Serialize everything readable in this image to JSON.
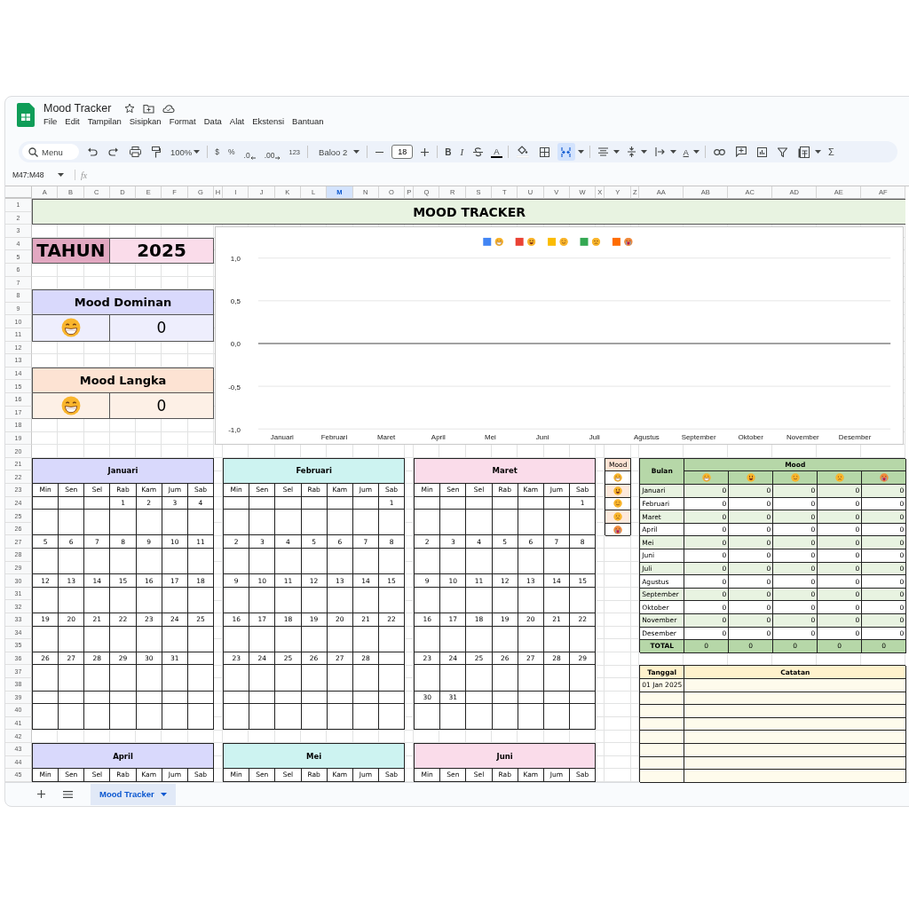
{
  "document": {
    "title": "Mood Tracker",
    "menu": [
      "File",
      "Edit",
      "Tampilan",
      "Sisipkan",
      "Format",
      "Data",
      "Alat",
      "Ekstensi",
      "Bantuan"
    ]
  },
  "toolbar": {
    "search_placeholder": "Menu",
    "zoom": "100%",
    "currency": "$",
    "percent": "%",
    "decrease_decimals": ".0",
    "increase_decimals": ".00",
    "number_format": "123",
    "font": "Baloo 2",
    "font_size": "18",
    "bold": "B",
    "italic": "I",
    "text_color": "A",
    "text_rotation": "A",
    "sum": "Σ",
    "merge_selected": true
  },
  "formula_bar": {
    "cell_range": "M47:M48",
    "function_label": "fx"
  },
  "columns": [
    {
      "label": "A",
      "selected": false
    },
    {
      "label": "B",
      "selected": false
    },
    {
      "label": "C",
      "selected": false
    },
    {
      "label": "D",
      "selected": false
    },
    {
      "label": "E",
      "selected": false
    },
    {
      "label": "F",
      "selected": false
    },
    {
      "label": "G",
      "selected": false
    },
    {
      "label": "H",
      "selected": false
    },
    {
      "label": "I",
      "selected": false
    },
    {
      "label": "J",
      "selected": false
    },
    {
      "label": "K",
      "selected": false
    },
    {
      "label": "L",
      "selected": false
    },
    {
      "label": "M",
      "selected": true
    },
    {
      "label": "N",
      "selected": false
    },
    {
      "label": "O",
      "selected": false
    },
    {
      "label": "P",
      "selected": false
    },
    {
      "label": "Q",
      "selected": false
    },
    {
      "label": "R",
      "selected": false
    },
    {
      "label": "S",
      "selected": false
    },
    {
      "label": "T",
      "selected": false
    },
    {
      "label": "U",
      "selected": false
    },
    {
      "label": "V",
      "selected": false
    },
    {
      "label": "W",
      "selected": false
    },
    {
      "label": "X",
      "selected": false
    },
    {
      "label": "Y",
      "selected": false
    },
    {
      "label": "Z",
      "selected": false
    },
    {
      "label": "AA",
      "selected": false
    },
    {
      "label": "AB",
      "selected": false
    },
    {
      "label": "AC",
      "selected": false
    },
    {
      "label": "AD",
      "selected": false
    },
    {
      "label": "AE",
      "selected": false
    },
    {
      "label": "AF",
      "selected": false
    }
  ],
  "rows": [
    "1",
    "2",
    "3",
    "4",
    "5",
    "6",
    "7",
    "8",
    "9",
    "10",
    "11",
    "12",
    "13",
    "14",
    "15",
    "16",
    "17",
    "18",
    "19",
    "20",
    "21",
    "22",
    "23",
    "24",
    "25",
    "26",
    "27",
    "28",
    "29",
    "30",
    "31",
    "32",
    "33",
    "34",
    "35",
    "36",
    "37",
    "38",
    "39",
    "40",
    "41",
    "42",
    "43",
    "44",
    "45"
  ],
  "title": "MOOD TRACKER",
  "year": {
    "label": "TAHUN",
    "value": "2025"
  },
  "dominant": {
    "title": "Mood Dominan",
    "count": "0"
  },
  "rare": {
    "title": "Mood Langka",
    "count": "0"
  },
  "chart": {
    "chart_data": {
      "type": "line",
      "categories": [
        "Januari",
        "Februari",
        "Maret",
        "April",
        "Mei",
        "Juni",
        "Juli",
        "Agustus",
        "September",
        "Oktober",
        "November",
        "Desember"
      ],
      "ylim": [
        -1,
        1
      ],
      "yticks": [
        {
          "value": -1,
          "label": "-1,0"
        },
        {
          "value": -0.5,
          "label": "-0,5"
        },
        {
          "value": 0,
          "label": "0,0"
        },
        {
          "value": 0.5,
          "label": "0,5"
        },
        {
          "value": 1,
          "label": "1,0"
        }
      ],
      "series": [
        {
          "color": "#4285f4",
          "values": [
            null,
            null,
            null,
            null,
            null,
            null,
            null,
            null,
            null,
            null,
            null,
            null
          ]
        },
        {
          "color": "#ea4335",
          "values": [
            null,
            null,
            null,
            null,
            null,
            null,
            null,
            null,
            null,
            null,
            null,
            null
          ]
        },
        {
          "color": "#fbbc04",
          "values": [
            null,
            null,
            null,
            null,
            null,
            null,
            null,
            null,
            null,
            null,
            null,
            null
          ]
        },
        {
          "color": "#34a853",
          "values": [
            null,
            null,
            null,
            null,
            null,
            null,
            null,
            null,
            null,
            null,
            null,
            null
          ]
        },
        {
          "color": "#ff6d01",
          "values": [
            null,
            null,
            null,
            null,
            null,
            null,
            null,
            null,
            null,
            null,
            null,
            null
          ]
        }
      ]
    }
  },
  "calendars": [
    {
      "name": "Januari",
      "color": "#d9d9fc",
      "day_names": [
        "Min",
        "Sen",
        "Sel",
        "Rab",
        "Kam",
        "Jum",
        "Sab"
      ],
      "weeks": [
        {
          "days": [
            "1",
            "2",
            "3",
            "4"
          ]
        },
        {
          "days": [
            "5",
            "6",
            "7",
            "8",
            "9",
            "10",
            "11"
          ]
        },
        {
          "days": [
            "12",
            "13",
            "14",
            "15",
            "16",
            "17",
            "18"
          ]
        },
        {
          "days": [
            "19",
            "20",
            "21",
            "22",
            "23",
            "24",
            "25"
          ]
        },
        {
          "days": [
            "26",
            "27",
            "28",
            "29",
            "30",
            "31"
          ]
        }
      ]
    },
    {
      "name": "Februari",
      "color": "#cdf3f1",
      "day_names": [
        "Min",
        "Sen",
        "Sel",
        "Rab",
        "Kam",
        "Jum",
        "Sab"
      ],
      "weeks": [
        {
          "days": [
            "1"
          ]
        },
        {
          "days": [
            "2",
            "3",
            "4",
            "5",
            "6",
            "7",
            "8"
          ]
        },
        {
          "days": [
            "9",
            "10",
            "11",
            "12",
            "13",
            "14",
            "15"
          ]
        },
        {
          "days": [
            "16",
            "17",
            "18",
            "19",
            "20",
            "21",
            "22"
          ]
        },
        {
          "days": [
            "23",
            "24",
            "25",
            "26",
            "27",
            "28"
          ]
        }
      ]
    },
    {
      "name": "Maret",
      "color": "#fadcea",
      "day_names": [
        "Min",
        "Sen",
        "Sel",
        "Rab",
        "Kam",
        "Jum",
        "Sab"
      ],
      "weeks": [
        {
          "days": [
            "1"
          ]
        },
        {
          "days": [
            "2",
            "3",
            "4",
            "5",
            "6",
            "7",
            "8"
          ]
        },
        {
          "days": [
            "9",
            "10",
            "11",
            "12",
            "13",
            "14",
            "15"
          ]
        },
        {
          "days": [
            "16",
            "17",
            "18",
            "19",
            "20",
            "21",
            "22"
          ]
        },
        {
          "days": [
            "23",
            "24",
            "25",
            "26",
            "27",
            "28",
            "29"
          ]
        },
        {
          "days": [
            "30",
            "31"
          ]
        }
      ]
    },
    {
      "name": "April",
      "color": "#d9d9fc",
      "day_names": [
        "Min",
        "Sen",
        "Sel",
        "Rab",
        "Kam",
        "Jum",
        "Sab"
      ]
    },
    {
      "name": "Mei",
      "color": "#cdf3f1",
      "day_names": [
        "Min",
        "Sen",
        "Sel",
        "Rab",
        "Kam",
        "Jum",
        "Sab"
      ]
    },
    {
      "name": "Juni",
      "color": "#fadcea",
      "day_names": [
        "Min",
        "Sen",
        "Sel",
        "Rab",
        "Kam",
        "Jum",
        "Sab"
      ]
    }
  ],
  "mood_legend": {
    "header": "Mood"
  },
  "summary": {
    "month_header": "Bulan",
    "mood_header": "Mood",
    "rows": [
      {
        "month": "Januari",
        "values": [
          "0",
          "0",
          "0",
          "0",
          "0"
        ]
      },
      {
        "month": "Februari",
        "values": [
          "0",
          "0",
          "0",
          "0",
          "0"
        ]
      },
      {
        "month": "Maret",
        "values": [
          "0",
          "0",
          "0",
          "0",
          "0"
        ]
      },
      {
        "month": "April",
        "values": [
          "0",
          "0",
          "0",
          "0",
          "0"
        ]
      },
      {
        "month": "Mei",
        "values": [
          "0",
          "0",
          "0",
          "0",
          "0"
        ]
      },
      {
        "month": "Juni",
        "values": [
          "0",
          "0",
          "0",
          "0",
          "0"
        ]
      },
      {
        "month": "Juli",
        "values": [
          "0",
          "0",
          "0",
          "0",
          "0"
        ]
      },
      {
        "month": "Agustus",
        "values": [
          "0",
          "0",
          "0",
          "0",
          "0"
        ]
      },
      {
        "month": "September",
        "values": [
          "0",
          "0",
          "0",
          "0",
          "0"
        ]
      },
      {
        "month": "Oktober",
        "values": [
          "0",
          "0",
          "0",
          "0",
          "0"
        ]
      },
      {
        "month": "November",
        "values": [
          "0",
          "0",
          "0",
          "0",
          "0"
        ]
      },
      {
        "month": "Desember",
        "values": [
          "0",
          "0",
          "0",
          "0",
          "0"
        ]
      }
    ],
    "total": {
      "label": "TOTAL",
      "values": [
        "0",
        "0",
        "0",
        "0",
        "0"
      ]
    }
  },
  "notes": {
    "date_header": "Tanggal",
    "note_header": "Catatan",
    "rows": [
      {
        "date": "01 Jan 2025"
      }
    ]
  },
  "sheet_tabs": [
    {
      "label": "Mood Tracker",
      "selected": true
    }
  ]
}
